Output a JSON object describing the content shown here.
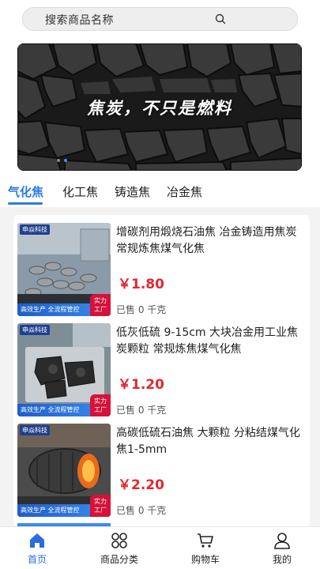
{
  "search": {
    "placeholder": "搜索商品名称",
    "icon": "search-icon"
  },
  "banner": {
    "slogan": "焦炭，不只是燃料",
    "slide_count": 2,
    "active_slide": 2
  },
  "tabs": [
    {
      "label": "气化焦",
      "active": true
    },
    {
      "label": "化工焦",
      "active": false
    },
    {
      "label": "铸造焦",
      "active": false
    },
    {
      "label": "冶金焦",
      "active": false
    }
  ],
  "products": [
    {
      "title": "增碳剂用煅烧石油焦 冶金铸造用焦炭 常规炼焦煤气化焦",
      "price": "￥1.80",
      "sold": "已售 0 千克",
      "brand": "申焱科技",
      "strip": "高效生产 全流程管控",
      "badge": "实力工厂"
    },
    {
      "title": "低灰低硫 9-15cm 大块冶金用工业焦炭颗粒 常规炼焦煤气化焦",
      "price": "￥1.20",
      "sold": "已售 0 千克",
      "brand": "申焱科技",
      "strip": "高效生产 全流程管控",
      "badge": "实力工厂"
    },
    {
      "title": "高碳低硫石油焦 大颗粒 分粘结煤气化焦1-5mm",
      "price": "￥2.20",
      "sold": "已售 0 千克",
      "brand": "申焱科技",
      "strip": "高效生产 全流程管控",
      "badge": "实力工厂"
    }
  ],
  "nav": [
    {
      "label": "首页",
      "icon": "home-icon",
      "active": true
    },
    {
      "label": "商品分类",
      "icon": "category-icon",
      "active": false
    },
    {
      "label": "购物车",
      "icon": "cart-icon",
      "active": false
    },
    {
      "label": "我的",
      "icon": "user-icon",
      "active": false
    }
  ],
  "colors": {
    "accent": "#2a7de1",
    "price": "#e4262e",
    "nav_active": "#2a6be0"
  }
}
